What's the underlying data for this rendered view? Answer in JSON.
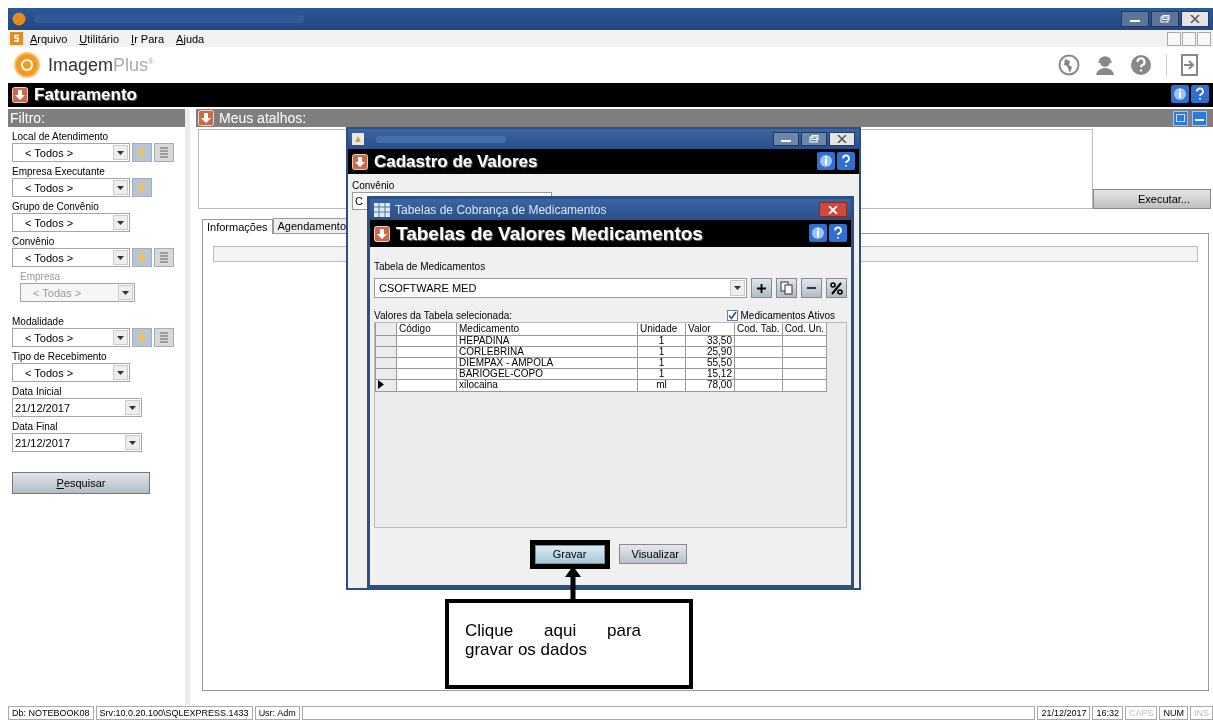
{
  "menu": [
    "Arquivo",
    "Utilitário",
    "Ir Para",
    "Ajuda"
  ],
  "brand": {
    "name": "Imagem",
    "suffix": "Plus$^{®}$"
  },
  "module_title": "Faturamento",
  "filter": {
    "title": "Filtro:",
    "fields": [
      {
        "label": "Local de Atendimento",
        "value": "< Todos >",
        "kind": "combo",
        "disabled": false,
        "lookup": true,
        "list": true
      },
      {
        "label": "Empresa Executante",
        "value": "< Todos >",
        "kind": "combo",
        "disabled": false,
        "lookup": true,
        "list": false
      },
      {
        "label": "Grupo de Convênio",
        "value": "< Todos >",
        "kind": "combo",
        "disabled": false,
        "lookup": false,
        "list": false
      },
      {
        "label": "Convênio",
        "value": "< Todos >",
        "kind": "combo",
        "disabled": false,
        "lookup": true,
        "list": true
      },
      {
        "label": "Empresa",
        "value": "< Todas >",
        "kind": "subcombo",
        "disabled": true,
        "lookup": false,
        "list": false
      },
      {
        "label": "Modalidade",
        "value": "< Todos >",
        "kind": "combo",
        "disabled": false,
        "lookup": true,
        "list": true
      },
      {
        "label": "Tipo de Recebimento",
        "value": "< Todos >",
        "kind": "combo",
        "disabled": false,
        "lookup": false,
        "list": false
      },
      {
        "label": "Data Inicial",
        "value": "21/12/2017",
        "kind": "date",
        "disabled": false,
        "lookup": false,
        "list": false
      },
      {
        "label": "Data Final",
        "value": "21/12/2017",
        "kind": "date",
        "disabled": false,
        "lookup": false,
        "list": false
      }
    ],
    "search_button": "Pesquisar"
  },
  "shortcuts": {
    "title": "Meus atalhos:",
    "run_button": "Executar..."
  },
  "tabs": [
    {
      "label": "Informações",
      "selected": true
    },
    {
      "label": "Agendamento",
      "selected": false
    }
  ],
  "dialog": {
    "title": "Cadastro de Valores",
    "field_label": "Convênio",
    "field_value": "C"
  },
  "inner_dialog": {
    "window_title": "Tabelas de Cobrança de Medicamentos",
    "title": "Tabelas de Valores Medicamentos",
    "table_label": "Tabela de Medicamentos",
    "table_value": "CSOFTWARE MED",
    "list_caption": "Valores da Tabela selecionada:",
    "active_filter": {
      "label": "Medicamentos Ativos",
      "checked": true
    },
    "columns": [
      "Código",
      "Medicamento",
      "Unidade",
      "Valor",
      "Cod. Tab.",
      "Cod. Un."
    ],
    "rows": [
      {
        "cells": [
          "",
          "HEPADINA",
          "1",
          "33,50",
          "",
          ""
        ],
        "selected": false
      },
      {
        "cells": [
          "",
          "CORLEBRINA",
          "1",
          "25,90",
          "",
          ""
        ],
        "selected": false
      },
      {
        "cells": [
          "",
          "DIEMPAX - AMPOLA",
          "1",
          "55,50",
          "",
          ""
        ],
        "selected": false
      },
      {
        "cells": [
          "",
          "BARIOGEL-COPO",
          "1",
          "15,12",
          "",
          ""
        ],
        "selected": false
      },
      {
        "cells": [
          "",
          "xilocaina",
          "ml",
          "78,00",
          "",
          ""
        ],
        "selected": true
      }
    ],
    "buttons": [
      {
        "label": "Gravar",
        "highlighted": true
      },
      {
        "label": "Visualizar",
        "highlighted": false
      }
    ]
  },
  "callout": "Clique aqui para gravar os dados",
  "status_bar": {
    "left": [
      "Db: NOTEBOOK08",
      "Srv:10.0.20.100\\SQLEXPRESS.1433",
      "Usr: Adm"
    ],
    "right": [
      {
        "text": "21/12/2017",
        "disabled": false
      },
      {
        "text": "16:32",
        "disabled": false
      },
      {
        "text": "CAPS",
        "disabled": true
      },
      {
        "text": "NUM",
        "disabled": false
      },
      {
        "text": "INS",
        "disabled": true
      }
    ]
  }
}
